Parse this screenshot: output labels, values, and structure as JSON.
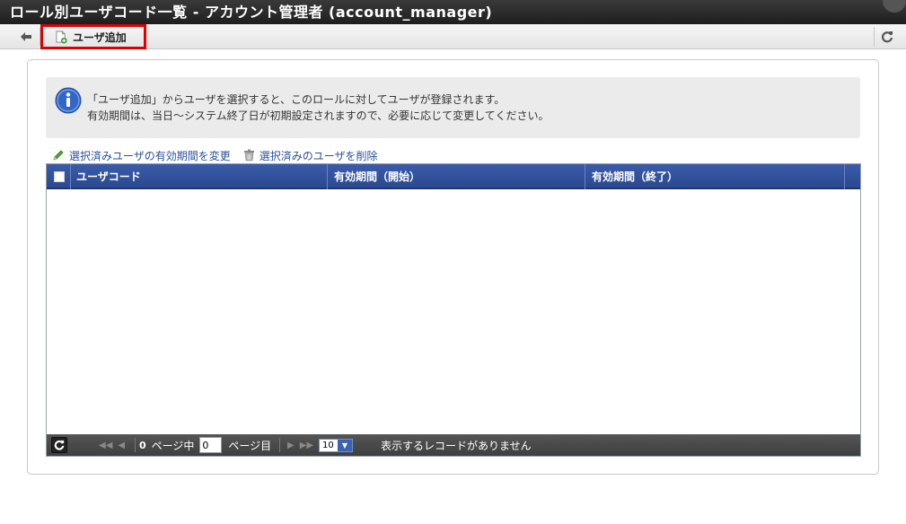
{
  "window": {
    "title": "ロール別ユーザコード一覧 - アカウント管理者 (account_manager)"
  },
  "toolbar": {
    "back_icon": "arrow-left-icon",
    "add_user_label": "ユーザ追加",
    "refresh_icon": "refresh-icon"
  },
  "info": {
    "line1": "「ユーザ追加」からユーザを選択すると、このロールに対してユーザが登録されます。",
    "line2": "有効期間は、当日～システム終了日が初期設定されますので、必要に応じて変更してください。"
  },
  "actions": {
    "edit_period": "選択済みユーザの有効期間を変更",
    "delete_users": "選択済みのユーザを削除"
  },
  "grid": {
    "columns": [
      "ユーザコード",
      "有効期間（開始）",
      "有効期間（終了）"
    ],
    "rows": []
  },
  "pager": {
    "total_pages": "0",
    "page_of_label": "ページ中",
    "page_value": "0",
    "page_suffix": "ページ目",
    "page_size": "10",
    "status": "表示するレコードがありません"
  },
  "colors": {
    "header_blue": "#2f4f9e",
    "pager_dark": "#4a4a4a",
    "highlight_red": "#e00000",
    "link_blue": "#2a4f9b"
  }
}
